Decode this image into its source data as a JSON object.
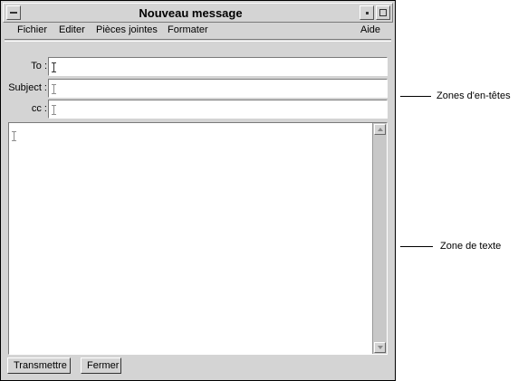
{
  "window": {
    "title": "Nouveau message"
  },
  "menubar": {
    "items": [
      {
        "label": "Fichier"
      },
      {
        "label": "Editer"
      },
      {
        "label": "Pièces jointes"
      },
      {
        "label": "Formater"
      },
      {
        "label": "Aide"
      }
    ]
  },
  "headers": {
    "to_label": "To :",
    "to_value": "",
    "subject_label": "Subject :",
    "subject_value": "",
    "cc_label": "cc :",
    "cc_value": ""
  },
  "body": {
    "text": ""
  },
  "buttons": {
    "send_label": "Transmettre",
    "close_label": "Fermer"
  },
  "annotations": {
    "headers_zone": "Zones d'en-têtes",
    "text_zone": "Zone de texte"
  }
}
